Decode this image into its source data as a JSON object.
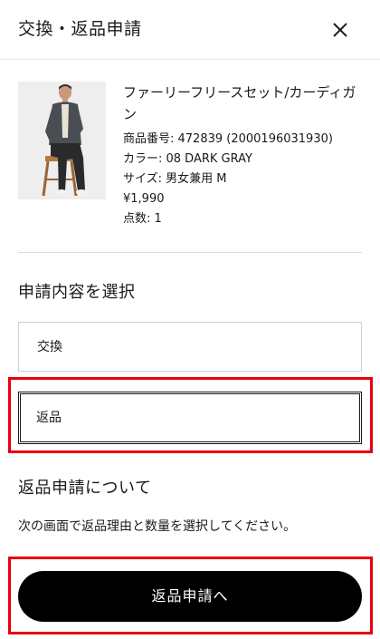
{
  "header": {
    "title": "交換・返品申請",
    "close_icon": "close-icon"
  },
  "product": {
    "image_icon": "product-photo",
    "name": "ファーリーフリースセット/カーディガン",
    "code_line": "商品番号: 472839 (2000196031930)",
    "color_line": "カラー: 08 DARK GRAY",
    "size_line": "サイズ: 男女兼用 M",
    "price_line": "¥1,990",
    "qty_line": "点数: 1"
  },
  "request_select": {
    "title": "申請内容を選択",
    "options": [
      {
        "label": "交換",
        "selected": false
      },
      {
        "label": "返品",
        "selected": true
      }
    ]
  },
  "about": {
    "title": "返品申請について",
    "description": "次の画面で返品理由と数量を選択してください。"
  },
  "cta": {
    "label": "返品申請へ"
  },
  "colors": {
    "highlight": "#e8000b",
    "button_bg": "#000000",
    "button_text": "#ffffff",
    "border": "#cfcfcf"
  }
}
